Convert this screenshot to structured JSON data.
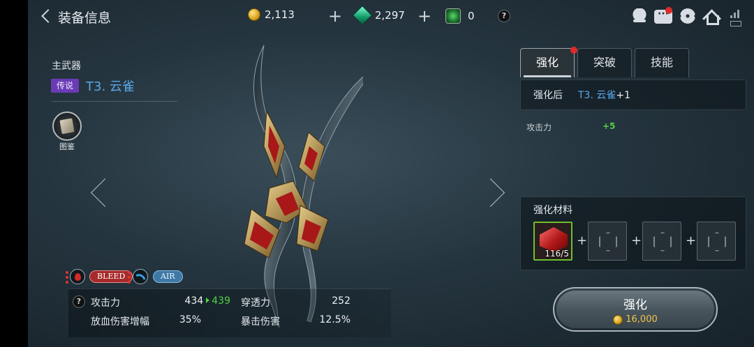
{
  "header": {
    "title": "装备信息",
    "gold": "2,113",
    "gems": "2,297",
    "green_gems": "0",
    "help": "?"
  },
  "item": {
    "slot": "主武器",
    "rarity": "传说",
    "name": "T3. 云雀",
    "codex_label": "图鉴"
  },
  "tags": {
    "bleed": "BLEED",
    "air": "AIR"
  },
  "stats": {
    "help": "?",
    "rows": [
      {
        "label": "攻击力",
        "value": "434",
        "new_value": "439"
      },
      {
        "label": "穿透力",
        "value": "252"
      },
      {
        "label": "放血伤害增幅",
        "value": "35%"
      },
      {
        "label": "暴击伤害",
        "value": "12.5%"
      }
    ]
  },
  "tabs": [
    {
      "label": "强化",
      "active": true
    },
    {
      "label": "突破",
      "active": false
    },
    {
      "label": "技能",
      "active": false
    }
  ],
  "enhance": {
    "after_label": "强化后",
    "after_name": "T3. 云雀",
    "after_plus": "+1",
    "attr_label": "攻击力",
    "attr_value": "+5"
  },
  "materials": {
    "title": "强化材料",
    "count": "116/5",
    "plus": "+"
  },
  "action": {
    "label": "强化",
    "cost": "16,000"
  },
  "colors": {
    "accent_blue": "#5ba8e8",
    "legendary_purple": "#6a3bb5",
    "positive_green": "#4fd143",
    "gold": "#f0c44a"
  }
}
